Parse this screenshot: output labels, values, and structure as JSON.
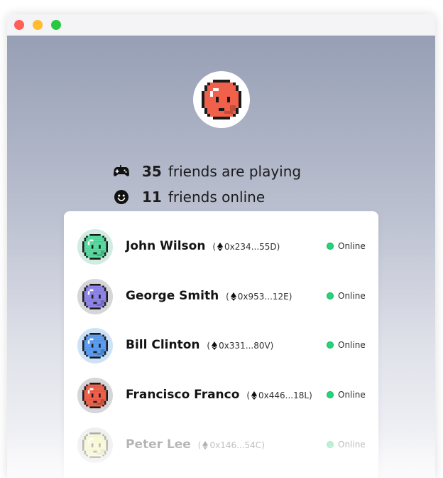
{
  "colors": {
    "online": "#25d37a",
    "hero_avatar": "#f0604a"
  },
  "stats": {
    "playing": {
      "icon": "gamepad-icon",
      "count": "35",
      "label": "friends are playing"
    },
    "online": {
      "icon": "smiley-icon",
      "count": "11",
      "label": "friends online"
    }
  },
  "friends": [
    {
      "name": "John Wilson",
      "open": "(",
      "address": "0x234...55D",
      "close": ")",
      "status": "Online",
      "avatar_color": "#58dca0",
      "avatar_bg": "#d3ece2"
    },
    {
      "name": "George Smith",
      "open": "(",
      "address": "0x953...12E",
      "close": ")",
      "status": "Online",
      "avatar_color": "#8f85ea",
      "avatar_bg": "#d6d6d9"
    },
    {
      "name": "Bill Clinton",
      "open": "(",
      "address": "0x331...80V",
      "close": ")",
      "status": "Online",
      "avatar_color": "#5b9ef2",
      "avatar_bg": "#cde2f7"
    },
    {
      "name": "Francisco Franco",
      "open": "(",
      "address": "0x446...18L",
      "close": ")",
      "status": "Online",
      "avatar_color": "#f0604a",
      "avatar_bg": "#d6d6d9"
    },
    {
      "name": "Peter Lee",
      "open": "(",
      "address": "0x146...54C",
      "close": ")",
      "status": "Online",
      "avatar_color": "#f2f08a",
      "avatar_bg": "#d6d6d9"
    }
  ]
}
